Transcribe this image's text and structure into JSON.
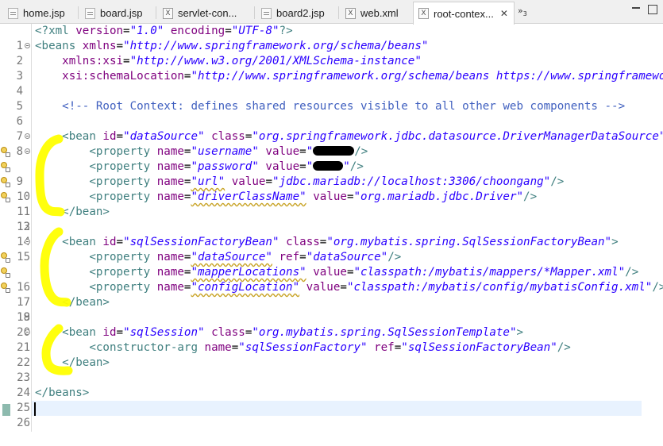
{
  "tabs": [
    {
      "label": "home.jsp",
      "icon": "jsp-file-icon",
      "active": false
    },
    {
      "label": "board.jsp",
      "icon": "jsp-file-icon",
      "active": false
    },
    {
      "label": "servlet-con...",
      "icon": "xml-file-icon",
      "active": false
    },
    {
      "label": "board2.jsp",
      "icon": "jsp-file-icon",
      "active": false
    },
    {
      "label": "web.xml",
      "icon": "xml-file-icon",
      "active": false
    },
    {
      "label": "root-contex...",
      "icon": "xml-file-icon",
      "active": true
    }
  ],
  "tab_close_glyph": "✕",
  "overflow": {
    "label": "»",
    "count": "3"
  },
  "line_numbers": [
    "1",
    "2",
    "3",
    "4",
    "5",
    "6",
    "7",
    "8",
    "9",
    "10",
    "11",
    "12",
    "13",
    "14",
    "15",
    "16",
    "17",
    "18",
    "19",
    "20",
    "21",
    "22",
    "23",
    "24",
    "25",
    "26"
  ],
  "code": {
    "l1": {
      "t1": "<?xml ",
      "a1": "version",
      "e1": "=",
      "v1": "\"1.0\"",
      "a2": " encoding",
      "e2": "=",
      "v2": "\"UTF-8\"",
      "t2": "?>"
    },
    "l2": {
      "t1": "<beans ",
      "a1": "xmlns",
      "e1": "=",
      "v1": "\"http://www.springframework.org/schema/beans\""
    },
    "l3": {
      "a1": "    xmlns:xsi",
      "e1": "=",
      "v1": "\"http://www.w3.org/2001/XMLSchema-instance\""
    },
    "l4": {
      "a1": "    xsi:schemaLocation",
      "e1": "=",
      "v1": "\"http://www.springframework.org/schema/beans https://www.springframework."
    },
    "l6": {
      "c1": "    <!-- Root Context: defines shared resources visible to all other web components -->"
    },
    "l8": {
      "t1": "    <bean ",
      "a1": "id",
      "e1": "=",
      "v1": "\"dataSource\"",
      "a2": " class",
      "e2": "=",
      "v2": "\"org.springframework.jdbc.datasource.DriverManagerDataSource\"",
      "t2": ">"
    },
    "l9": {
      "t1": "        <property ",
      "a1": "name",
      "e1": "=",
      "v1": "\"username\"",
      "a2": " value",
      "e2": "=",
      "v2": "\"",
      "t2": "/>"
    },
    "l10": {
      "t1": "        <property ",
      "a1": "name",
      "e1": "=",
      "v1": "\"password\"",
      "a2": " value",
      "e2": "=",
      "v2": "\"",
      "t2": "/>"
    },
    "l11": {
      "t1": "        <property ",
      "a1": "name",
      "e1": "=",
      "v1": "\"url\"",
      "a2": " value",
      "e2": "=",
      "v2": "\"jdbc.mariadb://localhost:3306/choongang\"",
      "t2": "/>"
    },
    "l12": {
      "t1": "        <property ",
      "a1": "name",
      "e1": "=",
      "v1": "\"driverClassName\"",
      "a2": " value",
      "e2": "=",
      "v2": "\"org.mariadb.jdbc.Driver\"",
      "t2": "/>"
    },
    "l13": {
      "t1": "    </bean>"
    },
    "l15": {
      "t1": "    <bean ",
      "a1": "id",
      "e1": "=",
      "v1": "\"sqlSessionFactoryBean\"",
      "a2": " class",
      "e2": "=",
      "v2": "\"org.mybatis.spring.SqlSessionFactoryBean\"",
      "t2": ">"
    },
    "l16": {
      "t1": "        <property ",
      "a1": "name",
      "e1": "=",
      "v1": "\"dataSource\"",
      "a2": " ref",
      "e2": "=",
      "v2": "\"dataSource\"",
      "t2": "/>"
    },
    "l17": {
      "t1": "        <property ",
      "a1": "name",
      "e1": "=",
      "v1": "\"mapperLocations\"",
      "a2": " value",
      "e2": "=",
      "v2": "\"classpath:/mybatis/mappers/*Mapper.xml\"",
      "t2": "/>"
    },
    "l18": {
      "t1": "        <property ",
      "a1": "name",
      "e1": "=",
      "v1": "\"configLocation\"",
      "a2": " value",
      "e2": "=",
      "v2": "\"classpath:/mybatis/config/mybatisConfig.xml\"",
      "t2": "/>"
    },
    "l19": {
      "t1": "    </bean>"
    },
    "l21": {
      "t1": "    <bean ",
      "a1": "id",
      "e1": "=",
      "v1": "\"sqlSession\"",
      "a2": " class",
      "e2": "=",
      "v2": "\"org.mybatis.spring.SqlSessionTemplate\"",
      "t2": ">"
    },
    "l22": {
      "t1": "        <constructor-arg ",
      "a1": "name",
      "e1": "=",
      "v1": "\"sqlSessionFactory\"",
      "a2": " ref",
      "e2": "=",
      "v2": "\"sqlSessionFactoryBean\"",
      "t2": "/>"
    },
    "l23": {
      "t1": "    </bean>"
    },
    "l25": {
      "t1": "</beans>"
    }
  },
  "colors": {
    "tag": "#3f7f7f",
    "attribute": "#7f007f",
    "value": "#2a00ff",
    "comment": "#3f5fbf",
    "highlight": "#ffff00",
    "current_line": "#e8f2fe"
  }
}
